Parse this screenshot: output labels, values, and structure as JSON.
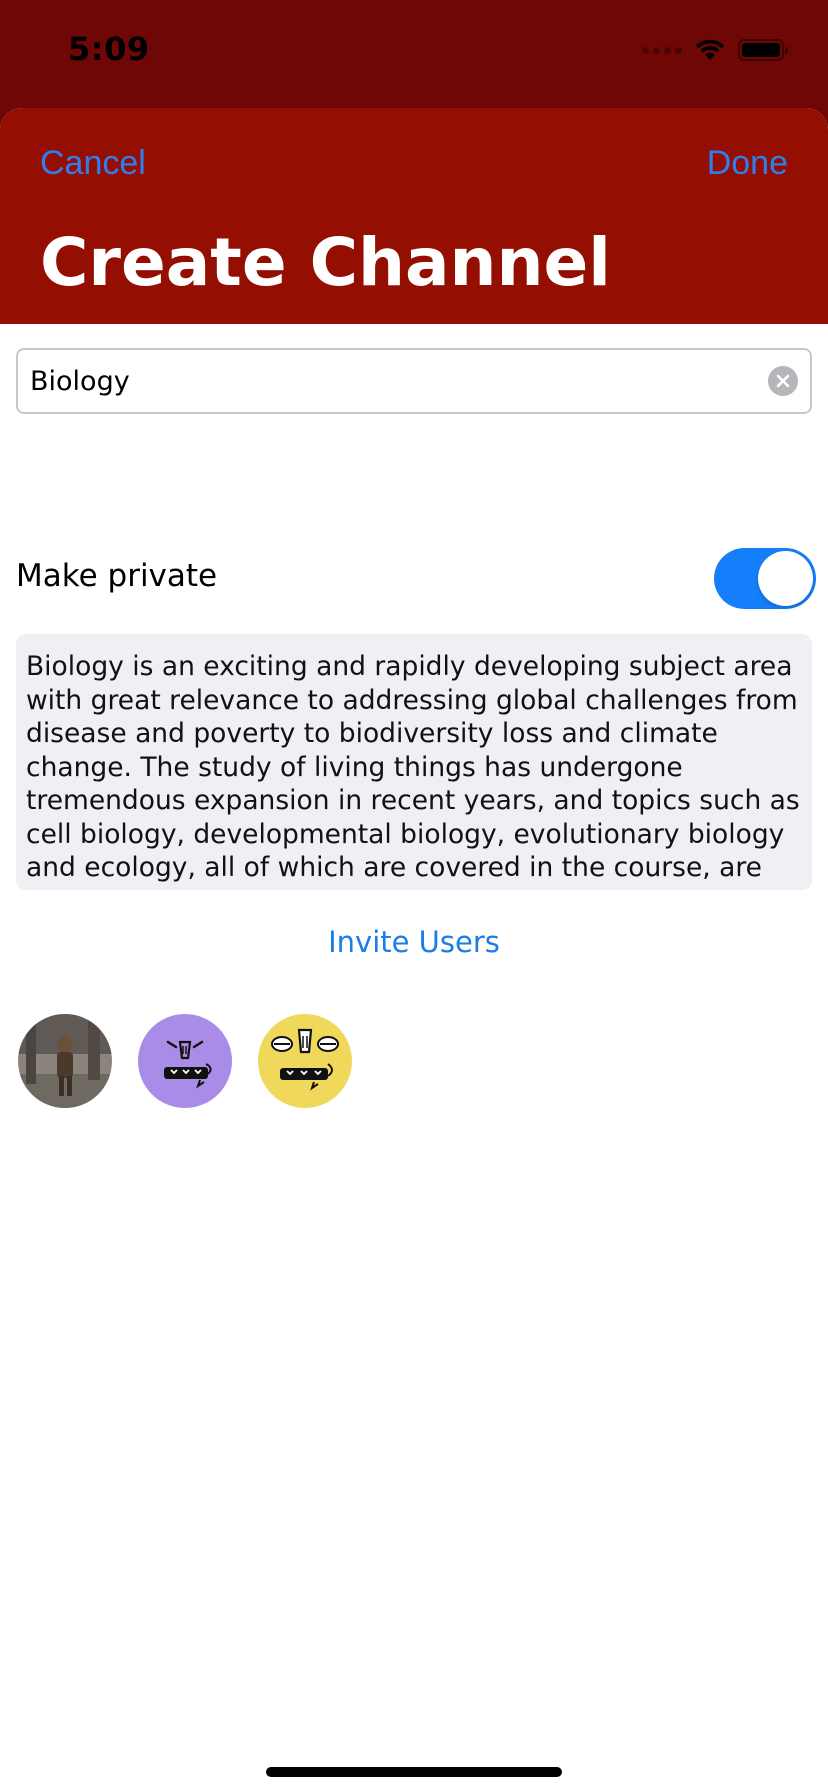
{
  "status_bar": {
    "time": "5:09",
    "icons": [
      "signal-icon",
      "wifi-icon",
      "battery-icon"
    ]
  },
  "nav": {
    "cancel_label": "Cancel",
    "done_label": "Done",
    "title": "Create Channel"
  },
  "form": {
    "channel_name": "Biology",
    "private_label": "Make private",
    "private_enabled": true,
    "description": "Biology is an exciting and rapidly developing subject area with great relevance to addressing global challenges from disease and poverty to biodiversity loss and climate change. The study of living things has undergone tremendous expansion in recent years, and topics such as cell biology, developmental biology, evolutionary biology and ecology, all of which are covered in the course, are"
  },
  "invite": {
    "label": "Invite Users"
  },
  "invited_users": [
    {
      "avatar": "photo-avatar",
      "color": "#7a7268"
    },
    {
      "avatar": "monster-avatar",
      "color": "#a98ce8"
    },
    {
      "avatar": "monster-avatar",
      "color": "#f0d85a"
    }
  ],
  "colors": {
    "header_red": "#940e02",
    "status_red": "#6e0705",
    "accent_blue": "#2f7ef0",
    "toggle_on": "#157efb",
    "description_bg": "#efeff4"
  }
}
